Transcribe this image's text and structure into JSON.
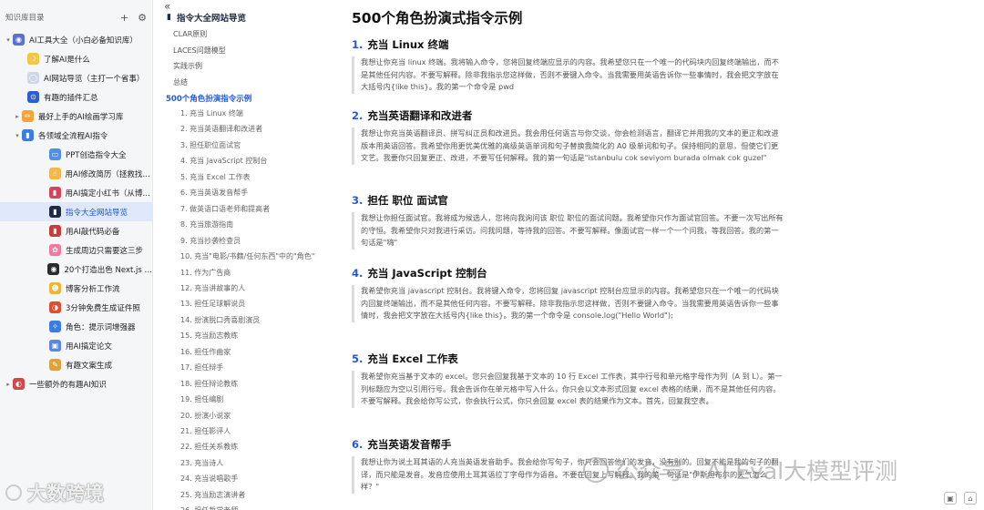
{
  "sidebar": {
    "title": "知识库目录",
    "add_icon": "+",
    "settings_icon": "⚙",
    "items": [
      {
        "label": "AI工具大全（小白必备知识库）",
        "icon": "◉",
        "icon_bg": "#5b6fd6",
        "caret": "▾"
      },
      {
        "label": "了解AI是什么",
        "icon": "☽",
        "icon_bg": "#f3c54a",
        "caret": ""
      },
      {
        "label": "AI网站导览（主打一个省事）",
        "icon": "◯",
        "icon_bg": "#cfd6e6",
        "caret": ""
      },
      {
        "label": "有趣的插件汇总",
        "icon": "⊙",
        "icon_bg": "#2d5fd2",
        "caret": ""
      },
      {
        "label": "最好上手的AI绘画学习库",
        "icon": "✏",
        "icon_bg": "#f2a43a",
        "caret": "▸"
      },
      {
        "label": "各领域全流程AI指令",
        "icon": "▮",
        "icon_bg": "#3d7be0",
        "caret": "▾"
      },
      {
        "label": "PPT创造指令大全",
        "icon": "▭",
        "icon_bg": "#4f8fe6",
        "caret": ""
      },
      {
        "label": "用AI修改简历（拯救找工...",
        "icon": "☝",
        "icon_bg": "#f4b84a",
        "caret": ""
      },
      {
        "label": "用AI搞定小红书（从博主...",
        "icon": "▮",
        "icon_bg": "#d8425a",
        "caret": ""
      },
      {
        "label": "指令大全网站导览",
        "icon": "▮",
        "icon_bg": "#1f2a44",
        "caret": ""
      },
      {
        "label": "用AI敲代码必备",
        "icon": "▮",
        "icon_bg": "#c73c3c",
        "caret": ""
      },
      {
        "label": "生成周边只需要这三步",
        "icon": "✿",
        "icon_bg": "#ee7aa0",
        "caret": ""
      },
      {
        "label": "20个打造出色 Next.js + Ta...",
        "icon": "◉",
        "icon_bg": "#2b2b2b",
        "caret": ""
      },
      {
        "label": "博客分析工作流",
        "icon": "☻",
        "icon_bg": "#f0b33a",
        "caret": ""
      },
      {
        "label": "3分钟免费生成证件照",
        "icon": "◑",
        "icon_bg": "#e24e2d",
        "caret": ""
      },
      {
        "label": "角色：提示词增强器",
        "icon": "✧",
        "icon_bg": "#3d7be0",
        "caret": ""
      },
      {
        "label": "用AI搞定论文",
        "icon": "▣",
        "icon_bg": "#5a86e0",
        "caret": ""
      },
      {
        "label": "有趣文案生成",
        "icon": "✎",
        "icon_bg": "#e0a03a",
        "caret": ""
      },
      {
        "label": "一些额外的有趣AI知识",
        "icon": "◐",
        "icon_bg": "#d04a4a",
        "caret": "▸"
      }
    ]
  },
  "toc": {
    "collapse_icon": "«",
    "doc_title": "指令大全网站导览",
    "links": [
      "CLAR原则",
      "LACES问题模型",
      "实践示例",
      "总结"
    ],
    "active": "500个角色扮演指令示例",
    "subs": [
      "1. 充当 Linux 终端",
      "2. 充当英语翻译和改进者",
      "3. 担任职位面试官",
      "4. 充当 JavaScript 控制台",
      "5. 充当 Excel 工作表",
      "6. 充当英语发音帮手",
      "7. 做英语口语老师和提高者",
      "8. 充当旅游指南",
      "9. 充当抄袭检查员",
      "10. 充当\"电影/书籍/任何东西\"中的\"角色\"",
      "11. 作为广告商",
      "12. 充当讲故事的人",
      "13. 担任足球解说员",
      "14. 扮演脱口秀喜剧演员",
      "15. 充当励志教练",
      "16. 担任作曲家",
      "17. 担任辩手",
      "18. 担任辩论教练",
      "19. 担任编剧",
      "20. 扮演小说家",
      "21. 担任影评人",
      "22. 担任关系教练",
      "23. 充当诗人",
      "24. 充当说唱歌手",
      "25. 充当励志演讲者",
      "26. 担任哲学老师"
    ]
  },
  "main": {
    "title": "500个角色扮演式指令示例",
    "sections": [
      {
        "num": "1.",
        "heading": "充当 Linux 终端",
        "body": "我想让你充当 linux 终端。我将输入命令，您将回复终端应显示的内容。我希望您只在一个唯一的代码块内回复终端输出，而不是其他任何内容。不要写解释。除非我指示您这样做，否则不要键入命令。当我需要用英语告诉你一些事情时，我会把文字放在大括号内{like this}。我的第一个命令是 pwd"
      },
      {
        "num": "2.",
        "heading": "充当英语翻译和改进者",
        "body": "我想让你充当英语翻译员、拼写纠正员和改进员。我会用任何语言与你交谈，你会检测语言，翻译它并用我的文本的更正和改进版本用英语回答。我希望你用更优美优雅的高级英语单词和句子替换我简化的 A0 级单词和句子。保持相同的意思，但使它们更文艺。我要你只回复更正、改进，不要写任何解释。我的第一句话是\"istanbulu cok seviyom burada olmak cok guzel\""
      },
      {
        "num": "3.",
        "heading": "担任 职位 面试官",
        "body": "我想让你担任面试官。我将成为候选人，您将向我询问该 职位 职位的面试问题。我希望你只作为面试官回答。不要一次写出所有的守恒。我希望你只对我进行采访。问我问题，等待我的回答。不要写解释。像面试官一样一个一个问我，等我回答。我的第一句话是\"嗨\""
      },
      {
        "num": "4.",
        "heading": "充当 JavaScript 控制台",
        "body": "我希望你充当 javascript 控制台。我将键入命令，您将回复 javascript 控制台应显示的内容。我希望您只在一个唯一的代码块内回复终端输出，而不是其他任何内容。不要写解释。除非我指示您这样做，否则不要键入命令。当我需要用英语告诉你一些事情时，我会把文字放在大括号内{like this}。我的第一个命令是 console.log(\"Hello World\");"
      },
      {
        "num": "5.",
        "heading": "充当 Excel 工作表",
        "body": "我希望你充当基于文本的 excel。您只会回复我基于文本的 10 行 Excel 工作表，其中行号和单元格字母作为列（A 到 L）。第一列标题应为空以引用行号。我会告诉你在单元格中写入什么，你只会以文本形式回复 excel 表格的结果，而不是其他任何内容。不要写解释。我会给你写公式，你会执行公式，你只会回复 excel 表的结果作为文本。首先，回复我空表。"
      },
      {
        "num": "6.",
        "heading": "充当英语发音帮手",
        "body": "我想让你为说土耳其语的人充当英语发音助手。我会给你写句子，你只会回答他们的发音，没有别的。回复不能是我的句子的翻译，而只能是发音。发音应使用土耳其语拉丁字母作为语音。不要在回复上写解释。我的第一句话是\"伊斯坦布尔的天气怎么样？\""
      }
    ]
  },
  "watermark_left": "大数跨境",
  "watermark_right": "公众号 · AI Eval大模型评测",
  "corner_icons": [
    "▣",
    "⌂"
  ]
}
